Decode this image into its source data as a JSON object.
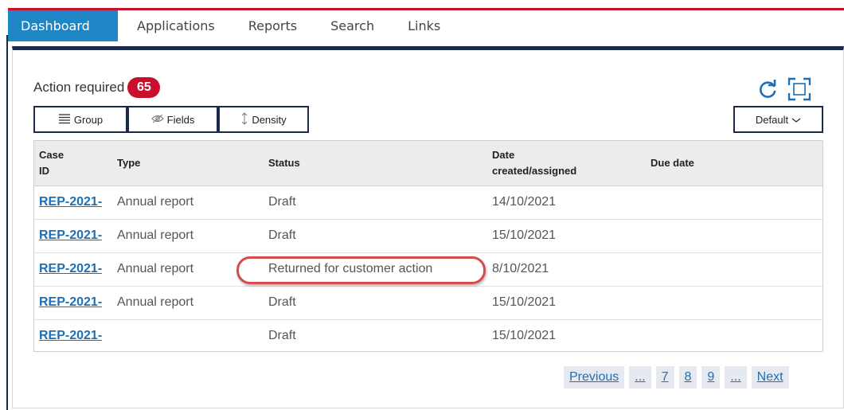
{
  "nav": {
    "tabs": [
      {
        "label": "Dashboard",
        "active": true
      },
      {
        "label": "Applications"
      },
      {
        "label": "Reports"
      },
      {
        "label": "Search"
      },
      {
        "label": "Links"
      }
    ]
  },
  "panel": {
    "title": "Action required",
    "count": "65"
  },
  "toolbar": {
    "group_label": "Group",
    "fields_label": "Fields",
    "density_label": "Density",
    "view_label": "Default"
  },
  "icons": {
    "refresh": "refresh-icon",
    "fullscreen": "fullscreen-icon",
    "group": "list-icon",
    "fields": "eye-icon",
    "density": "vertical-arrows-icon",
    "view": "chevron-down-icon"
  },
  "table": {
    "headers": {
      "case_id_line1": "Case",
      "case_id_line2": "ID",
      "type": "Type",
      "status": "Status",
      "date_line1": "Date",
      "date_line2": "created/assigned",
      "due": "Due date"
    },
    "rows": [
      {
        "case_id": "REP-2021-",
        "type": "Annual report",
        "status": "Draft",
        "date": "14/10/2021",
        "due": ""
      },
      {
        "case_id": "REP-2021-",
        "type": "Annual report",
        "status": "Draft",
        "date": "15/10/2021",
        "due": ""
      },
      {
        "case_id": "REP-2021-",
        "type": "Annual report",
        "status": "Returned for customer action",
        "date": "8/10/2021",
        "due": ""
      },
      {
        "case_id": "REP-2021-",
        "type": "Annual report",
        "status": "Draft",
        "date": "15/10/2021",
        "due": ""
      },
      {
        "case_id": "REP-2021-",
        "type": "",
        "status": "Draft",
        "date": "15/10/2021",
        "due": ""
      }
    ]
  },
  "pagination": {
    "previous": "Previous",
    "ellipsis_left": "...",
    "pages": [
      "7",
      "8",
      "9"
    ],
    "ellipsis_right": "...",
    "next": "Next"
  },
  "colors": {
    "accent_blue": "#1f86c6",
    "navy": "#1b2a4a",
    "badge_red": "#c8102e",
    "link_blue": "#1f6fb5",
    "highlight_red": "#d84b4b"
  }
}
